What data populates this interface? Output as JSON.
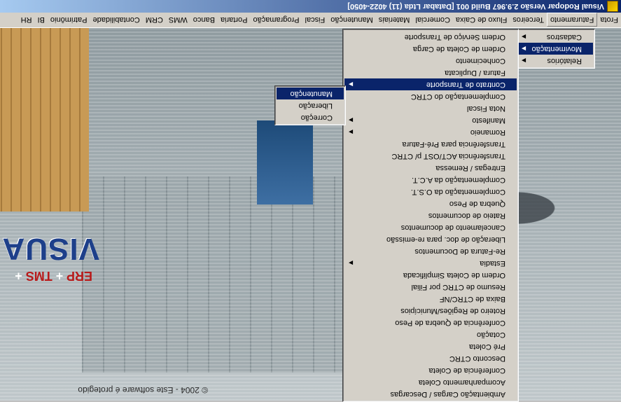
{
  "window": {
    "title": "Visual Rodopar Versão 2.9.967 Build 001 [Databar Ltda (11) 4022-4050]"
  },
  "branding": {
    "copyright": "© 2004 - Este software é protegido",
    "logo_text": "VISUAL",
    "tagline_left": "ERP",
    "tagline_plus": "+",
    "tagline_right": "TMS",
    "tagline_plus2": "+"
  },
  "menubar": {
    "items": [
      "Frota",
      "Faturamento",
      "Terceiros",
      "Fluxo de Caixa",
      "Comercial",
      "Materiais",
      "Manutenção",
      "Fiscal",
      "Programação",
      "Portaria",
      "Banco",
      "WMS",
      "CRM",
      "Contabilidade",
      "Patrimônio",
      "BI",
      "RH"
    ],
    "active": "Faturamento"
  },
  "menu_faturamento": {
    "items": [
      {
        "label": "Cadastros",
        "submenu": true
      },
      {
        "label": "Movimentação",
        "submenu": true,
        "selected": true
      },
      {
        "label": "Relatórios",
        "submenu": true
      }
    ]
  },
  "menu_movimentacao": {
    "items": [
      {
        "label": "Ordem Serviço de Transporte"
      },
      {
        "label": "Ordem de Coleta de Carga"
      },
      {
        "label": "Conhecimento"
      },
      {
        "label": "Fatura / Duplicata"
      },
      {
        "label": "Contrato de Transporte",
        "submenu": true,
        "selected": true
      },
      {
        "label": "Complementação do CTRC"
      },
      {
        "label": "Nota Fiscal"
      },
      {
        "label": "Manifesto",
        "submenu": true
      },
      {
        "label": "Romaneio",
        "submenu": true
      },
      {
        "label": "Transferência para Pré-Fatura"
      },
      {
        "label": "Transferência ACT/OST p/ CTRC"
      },
      {
        "label": "Entregas / Remessa"
      },
      {
        "label": "Complementação da A.C.T."
      },
      {
        "label": "Complementação da O.S.T."
      },
      {
        "label": "Quebra de Peso"
      },
      {
        "label": "Rateio de documentos"
      },
      {
        "label": "Cancelamento de documentos"
      },
      {
        "label": "Liberação de doc. para re-emissão"
      },
      {
        "label": "Re-Fatura de Documentos"
      },
      {
        "label": "Estadia",
        "submenu": true
      },
      {
        "label": "Ordem de Coleta Simplificada"
      },
      {
        "label": "Resumo de CTRC por Filial"
      },
      {
        "label": "Baixa de CTRC/NF"
      },
      {
        "label": "Roteiro de Regiões/Municípios"
      },
      {
        "label": "Conferência de Quebra de Peso"
      },
      {
        "label": "Cotação"
      },
      {
        "label": "Pré Coleta"
      },
      {
        "label": "Desconto CTRC"
      },
      {
        "label": "Conferência de Coleta"
      },
      {
        "label": "Acompanhamento Coleta"
      },
      {
        "label": "Ambientação Cargas / Descargas"
      }
    ]
  },
  "menu_contrato": {
    "items": [
      {
        "label": "Manutenção",
        "selected": true
      },
      {
        "label": "Liberação"
      },
      {
        "label": "Correção"
      }
    ]
  },
  "icons": {
    "app": "app-icon",
    "submenu": "chevron-right-icon"
  }
}
